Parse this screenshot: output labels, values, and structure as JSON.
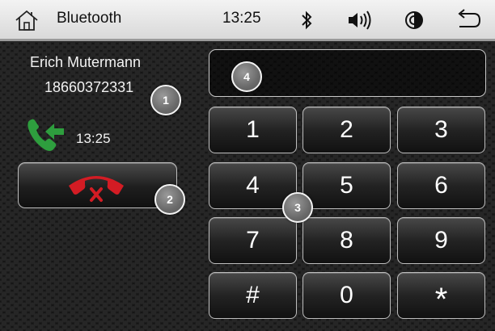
{
  "status_bar": {
    "title": "Bluetooth",
    "time": "13:25",
    "icons": [
      "home-icon",
      "bluetooth-icon",
      "volume-icon",
      "brightness-icon",
      "back-icon"
    ]
  },
  "call": {
    "caller_name": "Erich Mutermann",
    "caller_number": "18660372331",
    "call_direction_icon": "incoming-call-icon",
    "call_time": "13:25",
    "end_call_icon": "end-call-icon"
  },
  "number_display": {
    "value": ""
  },
  "keypad": {
    "keys": [
      "1",
      "2",
      "3",
      "4",
      "5",
      "6",
      "7",
      "8",
      "9",
      "#",
      "0",
      "*"
    ]
  },
  "markers": [
    "1",
    "2",
    "3",
    "4"
  ],
  "colors": {
    "incoming_call": "#2e9e3e",
    "end_call": "#d31c24",
    "marker_border": "#f4f4f4"
  }
}
